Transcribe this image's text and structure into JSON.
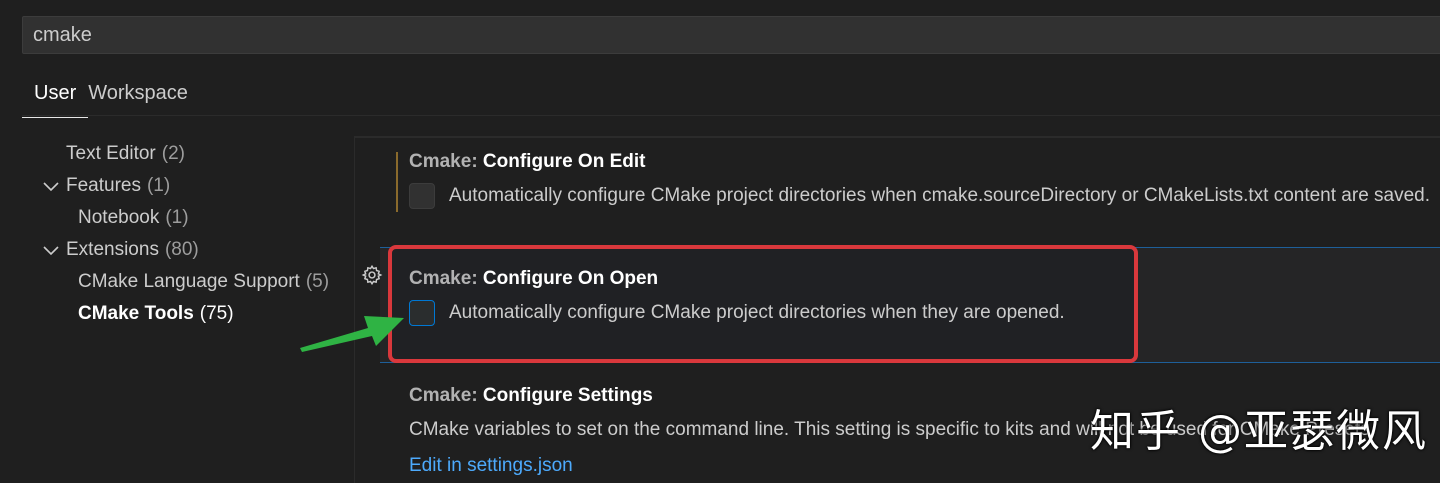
{
  "search": {
    "value": "cmake"
  },
  "tabs": [
    {
      "label": "User",
      "active": true
    },
    {
      "label": "Workspace",
      "active": false
    }
  ],
  "tree": [
    {
      "label": "Text Editor",
      "count": "(2)",
      "expandable": false
    },
    {
      "label": "Features",
      "count": "(1)",
      "expandable": true,
      "expanded": true
    },
    {
      "label": "Notebook",
      "count": "(1)",
      "expandable": false
    },
    {
      "label": "Extensions",
      "count": "(80)",
      "expandable": true,
      "expanded": true
    },
    {
      "label": "CMake Language Support",
      "count": "(5)",
      "expandable": false
    },
    {
      "label": "CMake Tools",
      "count": "(75)",
      "expandable": false,
      "selected": true
    }
  ],
  "settings": [
    {
      "category": "Cmake: ",
      "name": "Configure On Edit",
      "description": "Automatically configure CMake project directories when cmake.sourceDirectory or CMakeLists.txt content are saved.",
      "checked": false
    },
    {
      "category": "Cmake: ",
      "name": "Configure On Open",
      "description": "Automatically configure CMake project directories when they are opened.",
      "checked": false
    },
    {
      "category": "Cmake: ",
      "name": "Configure Settings",
      "description": "CMake variables to set on the command line. This setting is specific to kits and will not be used for CMake Presets.",
      "link": "Edit in settings.json"
    }
  ],
  "watermark": "知乎 @亚瑟微风",
  "colors": {
    "highlight_border": "#d9383c",
    "arrow": "#2fb344",
    "link": "#4daafc",
    "focus": "#0078d4"
  }
}
